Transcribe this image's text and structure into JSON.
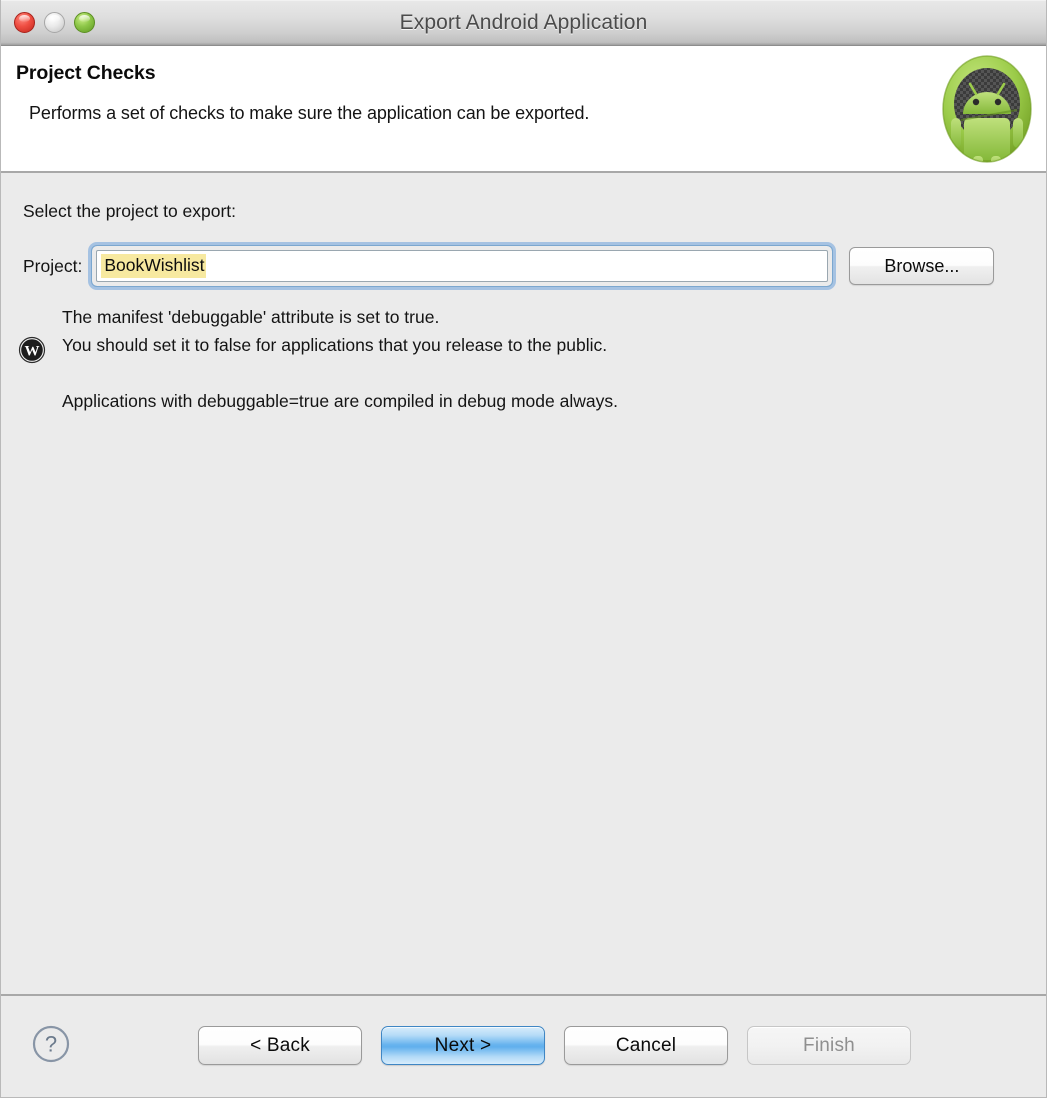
{
  "window": {
    "title": "Export Android Application",
    "traffic_lights": [
      {
        "name": "close-button",
        "color": "#ef4e42"
      },
      {
        "name": "minimize-button",
        "color": "#eaeaea"
      },
      {
        "name": "maximize-button",
        "color": "#8ec749"
      }
    ]
  },
  "header": {
    "title": "Project Checks",
    "description": "Performs a set of checks to make sure the application can be exported.",
    "logo_icon": "android-robot-icon"
  },
  "content": {
    "select_label": "Select the project to export:",
    "project": {
      "label": "Project:",
      "value": "BookWishlist",
      "placeholder": "",
      "highlight_color": "#f7e9a0",
      "focus_ring_color": "#7aaadd"
    },
    "browse_label": "Browse...",
    "warning": {
      "icon": "warning-w-icon",
      "lines": [
        "The manifest 'debuggable' attribute is set to true.",
        "You should set it to false for applications that you release to the public.",
        "",
        "Applications with debuggable=true are compiled in debug mode always."
      ]
    }
  },
  "footer": {
    "help_icon": "question-mark-icon",
    "buttons": [
      {
        "name": "back-button",
        "label": "< Back",
        "state": "normal"
      },
      {
        "name": "next-button",
        "label": "Next >",
        "state": "default"
      },
      {
        "name": "cancel-button",
        "label": "Cancel",
        "state": "normal"
      },
      {
        "name": "finish-button",
        "label": "Finish",
        "state": "disabled"
      }
    ],
    "default_button_color": "#61b0ed",
    "disabled_text_color": "#8f8f8f"
  }
}
